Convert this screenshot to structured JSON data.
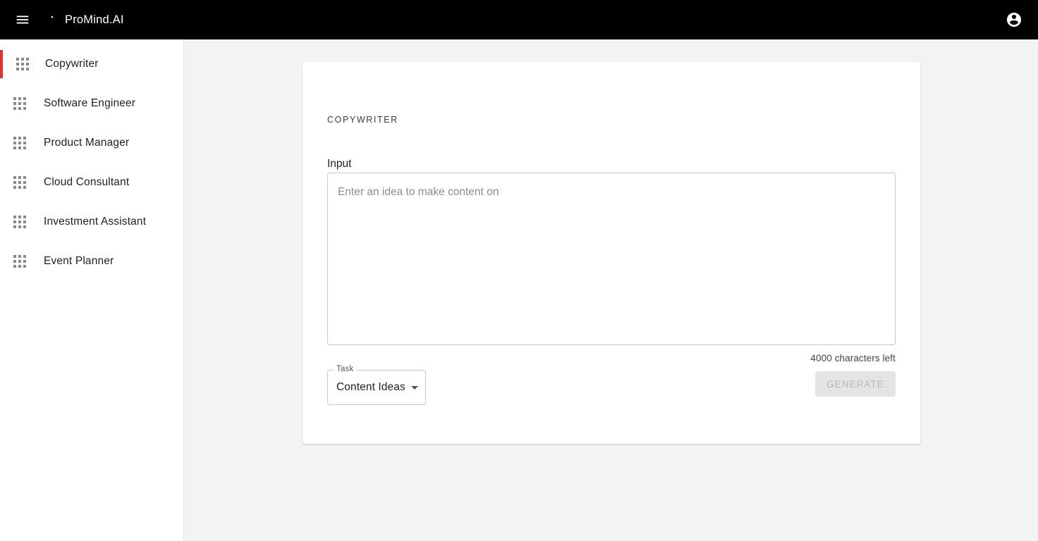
{
  "appbar": {
    "menu_icon": "hamburger-menu-icon",
    "logo_icon": "psychology-head-icon",
    "brand_name": "ProMind.AI",
    "account_icon": "account-circle-icon",
    "background_color": "#000000"
  },
  "sidebar": {
    "active_indicator_color": "#e03131",
    "items": [
      {
        "label": "Copywriter",
        "icon": "apps-grid-icon",
        "active": true
      },
      {
        "label": "Software Engineer",
        "icon": "apps-grid-icon",
        "active": false
      },
      {
        "label": "Product Manager",
        "icon": "apps-grid-icon",
        "active": false
      },
      {
        "label": "Cloud Consultant",
        "icon": "apps-grid-icon",
        "active": false
      },
      {
        "label": "Investment Assistant",
        "icon": "apps-grid-icon",
        "active": false
      },
      {
        "label": "Event Planner",
        "icon": "apps-grid-icon",
        "active": false
      }
    ]
  },
  "main": {
    "card_title": "COPYWRITER",
    "input": {
      "label": "Input",
      "value": "",
      "placeholder": "Enter an idea to make content on",
      "char_count_text": "4000 characters left"
    },
    "task_select": {
      "label": "Task",
      "selected_value": "Content Ideas",
      "caret_icon": "chevron-down-icon"
    },
    "generate_button": {
      "label": "GENERATE",
      "disabled": true
    }
  }
}
